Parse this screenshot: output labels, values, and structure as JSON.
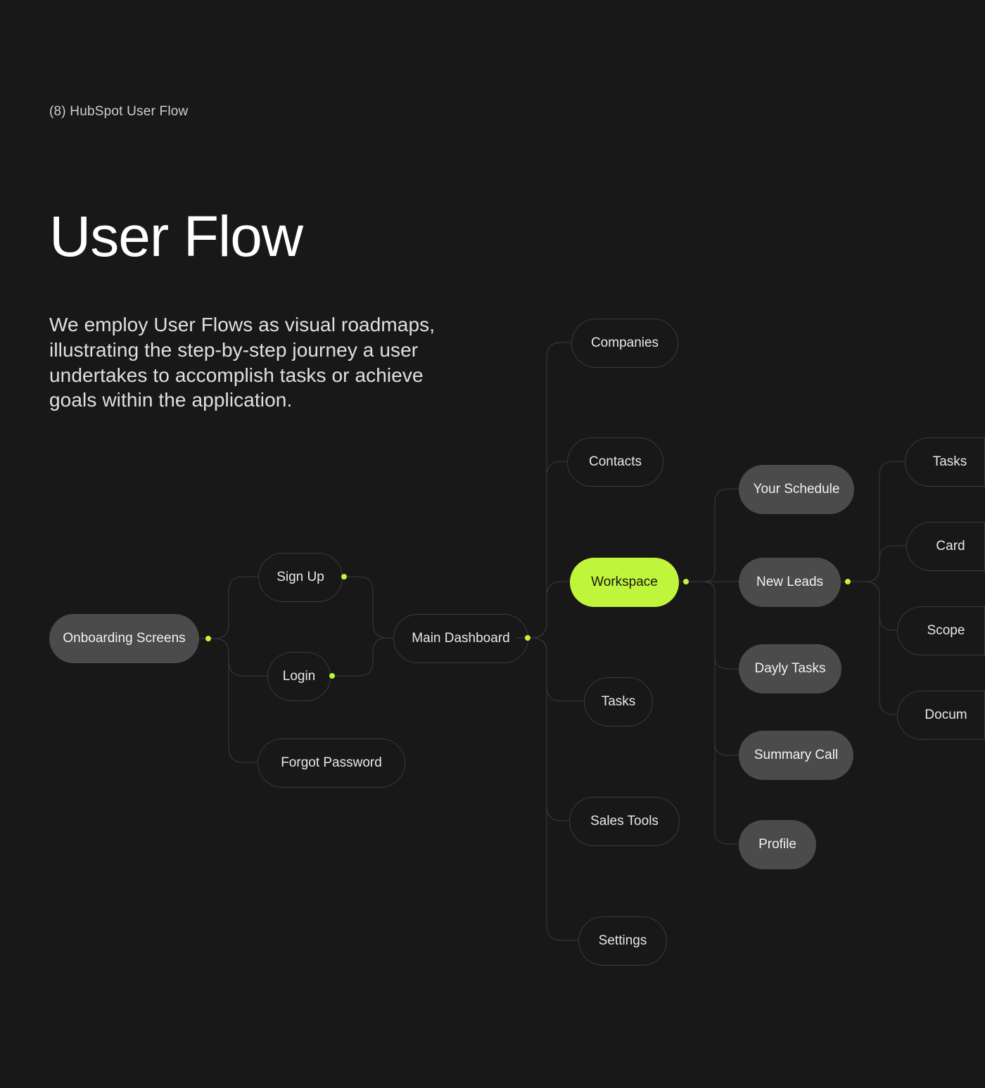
{
  "page_label": "(8) HubSpot User Flow",
  "title": "User Flow",
  "description": "We employ User Flows as visual roadmaps, illustrating the step-by-step journey a user undertakes to accomplish tasks or achieve goals within the application.",
  "nodes": {
    "onboarding": "Onboarding Screens",
    "signup": "Sign Up",
    "login": "Login",
    "forgot": "Forgot Password",
    "main_dashboard": "Main Dashboard",
    "companies": "Companies",
    "contacts": "Contacts",
    "workspace": "Workspace",
    "tasks": "Tasks",
    "sales_tools": "Sales Tools",
    "settings": "Settings",
    "your_schedule": "Your Schedule",
    "new_leads": "New Leads",
    "dayly_tasks": "Dayly Tasks",
    "summary_call": "Summary Call",
    "profile": "Profile",
    "tasks2": "Tasks",
    "card": "Card",
    "scope": "Scope",
    "docum": "Docum"
  }
}
